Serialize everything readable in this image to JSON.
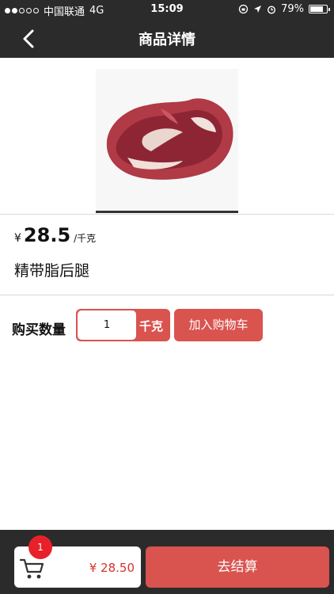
{
  "status_bar": {
    "carrier": "中国联通",
    "network": "4G",
    "time": "15:09",
    "battery": "79%",
    "battery_level": 0.79,
    "signal_bars_filled": 2,
    "signal_bars_total": 5
  },
  "nav": {
    "title": "商品详情",
    "back_icon": "chevron-left-icon"
  },
  "product": {
    "image_alt": "meat-image",
    "currency": "¥",
    "price": "28.5",
    "unit": "/千克",
    "name": "精带脂后腿"
  },
  "purchase": {
    "qty_label": "购买数量",
    "qty_value": "1",
    "qty_unit": "千克",
    "add_to_cart": "加入购物车"
  },
  "bottom_bar": {
    "cart_icon": "cart-icon",
    "cart_count": "1",
    "total": "¥ 28.50",
    "checkout": "去结算"
  },
  "colors": {
    "header_bg": "#2b2b2b",
    "accent": "#d9534f",
    "badge": "#e8202a",
    "price_text": "#d9312b"
  }
}
